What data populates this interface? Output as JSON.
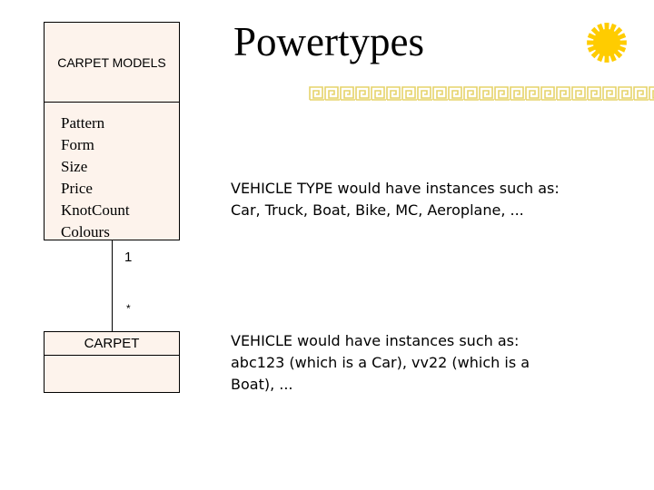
{
  "slide": {
    "title": "Powertypes",
    "decoration": {
      "sun_icon_color": "#FFCC00",
      "border_color": "#E6D36A"
    }
  },
  "diagram": {
    "powertype_class": {
      "name": "CARPET MODELS",
      "attributes": [
        "Pattern",
        "Form",
        "Size",
        "Price",
        "KnotCount",
        "Colours"
      ]
    },
    "instance_class": {
      "name": "CARPET"
    },
    "association": {
      "multiplicity_top": "1",
      "multiplicity_bottom": "*"
    },
    "box_fill_color": "#FDF3EC"
  },
  "text": {
    "vehicle_type_lines": [
      "VEHICLE TYPE would have instances such as:",
      "Car, Truck, Boat, Bike, MC, Aeroplane, ..."
    ],
    "vehicle_lines": [
      "VEHICLE would have instances such as:",
      "abc123 (which is a Car), vv22 (which is a",
      "Boat), ..."
    ]
  }
}
